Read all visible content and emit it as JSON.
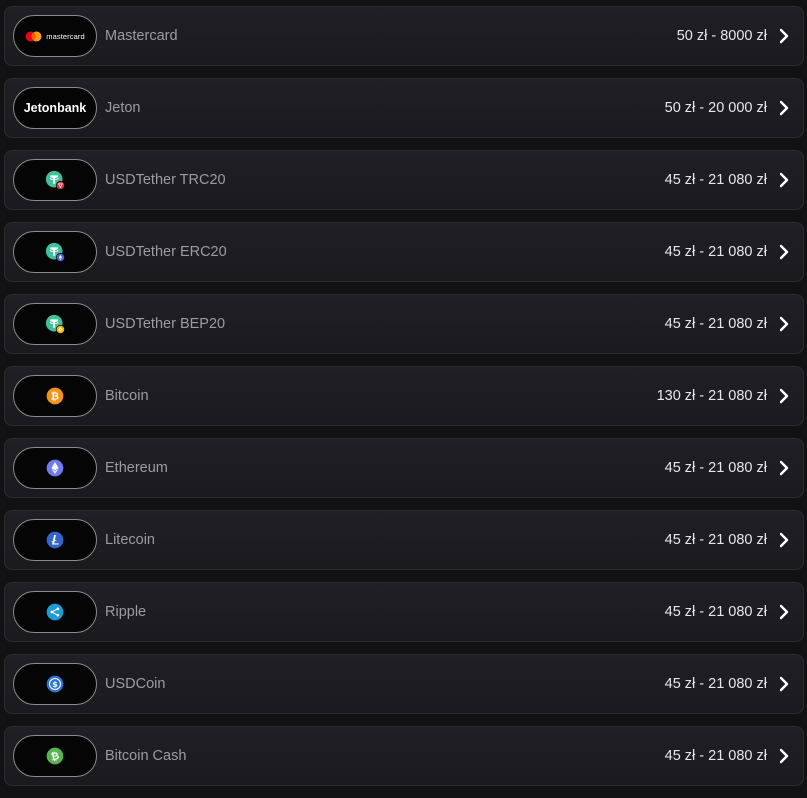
{
  "methods": [
    {
      "name": "Mastercard",
      "range": "50 zł - 8000 zł",
      "icon": "mastercard-logo",
      "logo_text": "mastercard"
    },
    {
      "name": "Jeton",
      "range": "50 zł - 20 000 zł",
      "icon": "jetonbank-logo",
      "logo_text": "Jetonbank"
    },
    {
      "name": "USDTether TRC20",
      "range": "45 zł - 21 080 zł",
      "icon": "tether-trc20-icon"
    },
    {
      "name": "USDTether ERC20",
      "range": "45 zł - 21 080 zł",
      "icon": "tether-erc20-icon"
    },
    {
      "name": "USDTether BEP20",
      "range": "45 zł - 21 080 zł",
      "icon": "tether-bep20-icon"
    },
    {
      "name": "Bitcoin",
      "range": "130 zł - 21 080 zł",
      "icon": "bitcoin-icon"
    },
    {
      "name": "Ethereum",
      "range": "45 zł - 21 080 zł",
      "icon": "ethereum-icon"
    },
    {
      "name": "Litecoin",
      "range": "45 zł - 21 080 zł",
      "icon": "litecoin-icon"
    },
    {
      "name": "Ripple",
      "range": "45 zł - 21 080 zł",
      "icon": "ripple-icon"
    },
    {
      "name": "USDCoin",
      "range": "45 zł - 21 080 zł",
      "icon": "usdcoin-icon"
    },
    {
      "name": "Bitcoin Cash",
      "range": "45 zł - 21 080 zł",
      "icon": "bitcoin-cash-icon"
    }
  ],
  "colors": {
    "tether": "#3fbf9a",
    "bitcoin": "#f1931b",
    "ethereum": "#6e7cf2",
    "litecoin": "#3466c9",
    "ripple": "#1b9ed6",
    "usdcoin": "#2f73d1",
    "bitcoin_cash": "#58b44f",
    "tron": "#d2333a",
    "erc": "#4c63d6",
    "bnb": "#f0b90b"
  }
}
